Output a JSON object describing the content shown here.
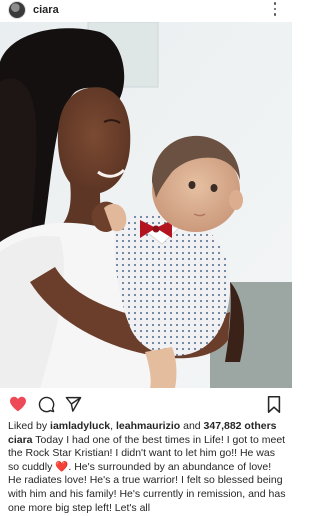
{
  "post": {
    "username": "ciara"
  },
  "likes": {
    "prefix": "Liked by ",
    "liker_1": "iamladyluck",
    "separator": ", ",
    "liker_2": "leahmaurizio",
    "and_text": " and ",
    "count_text": "347,882 others"
  },
  "caption": {
    "username": "ciara",
    "text_part1": " Today I had one of the best times in Life! I got to meet the Rock Star Kristian! I didn't want to let him go!! He was so cuddly ",
    "emoji": "❤️",
    "text_part2": ". He's surrounded by an abundance of love! He radiates love! He's a true warrior! I felt so blessed being with him and his family! He's currently in remission, and has one more big step left! Let's all"
  },
  "icons": {
    "avatar": "avatar",
    "more": "more-vertical-icon",
    "like": "heart-filled-icon",
    "comment": "comment-icon",
    "share": "send-icon",
    "save": "bookmark-icon"
  },
  "colors": {
    "like_red": "#ed4956",
    "text": "#262626",
    "bow_tie": "#b3121f"
  }
}
